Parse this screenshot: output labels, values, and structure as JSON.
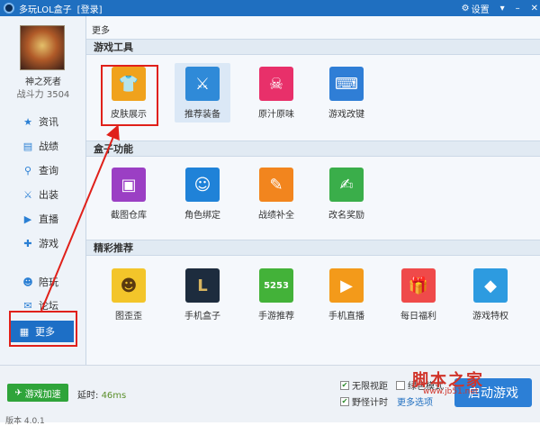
{
  "titlebar": {
    "title": "多玩LOL盒子",
    "login": "[登录]",
    "settings": "设置"
  },
  "sidebar": {
    "username": "神之死者",
    "power": "战斗力 3504",
    "nav": [
      {
        "label": "资讯",
        "icon": "star-icon"
      },
      {
        "label": "战绩",
        "icon": "chart-icon"
      },
      {
        "label": "查询",
        "icon": "search-icon"
      },
      {
        "label": "出装",
        "icon": "equipment-icon"
      },
      {
        "label": "直播",
        "icon": "play-icon"
      },
      {
        "label": "游戏",
        "icon": "gamepad-icon"
      },
      {
        "label": "陪玩",
        "icon": "people-icon"
      },
      {
        "label": "论坛",
        "icon": "chat-icon"
      },
      {
        "label": "更多",
        "icon": "grid-icon"
      }
    ]
  },
  "main": {
    "breadcrumb": "更多",
    "sections": [
      {
        "title": "游戏工具",
        "tools": [
          {
            "label": "皮肤展示",
            "icon": "tshirt-icon",
            "color": "#f0a21c"
          },
          {
            "label": "推荐装备",
            "icon": "sword-icon",
            "color": "#2f8ad8"
          },
          {
            "label": "原汁原味",
            "icon": "skull-icon",
            "color": "#e8306a"
          },
          {
            "label": "游戏改键",
            "icon": "keyboard-icon",
            "color": "#2f7ed6"
          }
        ]
      },
      {
        "title": "盒子功能",
        "tools": [
          {
            "label": "截图仓库",
            "icon": "screenshot-icon",
            "color": "#9b3fc4"
          },
          {
            "label": "角色绑定",
            "icon": "user-icon",
            "color": "#1f82d8"
          },
          {
            "label": "战绩补全",
            "icon": "edit-icon",
            "color": "#f2851e"
          },
          {
            "label": "改名奖励",
            "icon": "document-icon",
            "color": "#3aae4a"
          }
        ]
      },
      {
        "title": "精彩推荐",
        "tools": [
          {
            "label": "图歪歪",
            "icon": "face-icon",
            "color": "#f3c52a"
          },
          {
            "label": "手机盒子",
            "icon": "lol-icon",
            "color": "#1d2c3e"
          },
          {
            "label": "手游推荐",
            "icon": "5253-icon",
            "color": "#43b239"
          },
          {
            "label": "手机直播",
            "icon": "live-icon",
            "color": "#f39a1a"
          },
          {
            "label": "每日福利",
            "icon": "gift-icon",
            "color": "#ef4a4a"
          },
          {
            "label": "游戏特权",
            "icon": "diamond-icon",
            "color": "#2d9be0"
          }
        ]
      }
    ]
  },
  "footer": {
    "accel": "游戏加速",
    "delay_label": "延时:",
    "delay_value": "46ms",
    "opt1": "无限视距",
    "opt2": "绿色模式",
    "opt3": "野怪计时",
    "more_options": "更多选项",
    "start": "启动游戏",
    "version": "版本 4.0.1"
  },
  "watermark": {
    "text": "脚本之家",
    "url": "www.jb51.net"
  }
}
